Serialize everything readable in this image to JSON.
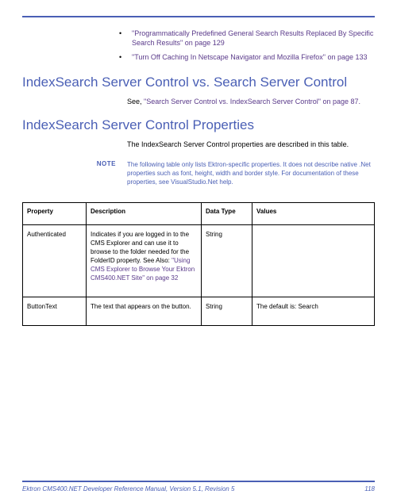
{
  "bullets": [
    {
      "text": "\"Programmatically Predefined General Search Results Replaced By Specific Search Results\" on page 129"
    },
    {
      "text": "\"Turn Off Caching In Netscape Navigator and Mozilla Firefox\" on page 133"
    }
  ],
  "heading1": "IndexSearch Server Control vs. Search Server Control",
  "see_prefix": "See, ",
  "see_link": "\"Search Server Control vs. IndexSearch Server Control\" on page 87.",
  "heading2": "IndexSearch Server Control Properties",
  "intro_para": "The IndexSearch Server Control properties are described in this table.",
  "note_label": "NOTE",
  "note_text": "The following table only lists Ektron-specific properties. It does not describe native .Net properties such as font, height, width and border style. For documentation of these properties, see VisualStudio.Net help.",
  "table": {
    "headers": {
      "c0": "Property",
      "c1": "Description",
      "c2": "Data Type",
      "c3": "Values"
    },
    "rows": [
      {
        "c0": "Authenticated",
        "c1_plain": "Indicates if you are logged in to the CMS Explorer and can use it to browse to the folder needed for the FolderID property. See Also: ",
        "c1_link": "\"Using CMS Explorer to Browse Your Ektron CMS400.NET Site\" on page 32",
        "c2": "String",
        "c3": ""
      },
      {
        "c0": "ButtonText",
        "c1_plain": "The text that appears on the button.",
        "c1_link": "",
        "c2": "String",
        "c3": "The default is: Search"
      }
    ]
  },
  "footer": {
    "title": "Ektron CMS400.NET Developer Reference Manual, Version 5.1, Revision 5",
    "page": "118"
  }
}
